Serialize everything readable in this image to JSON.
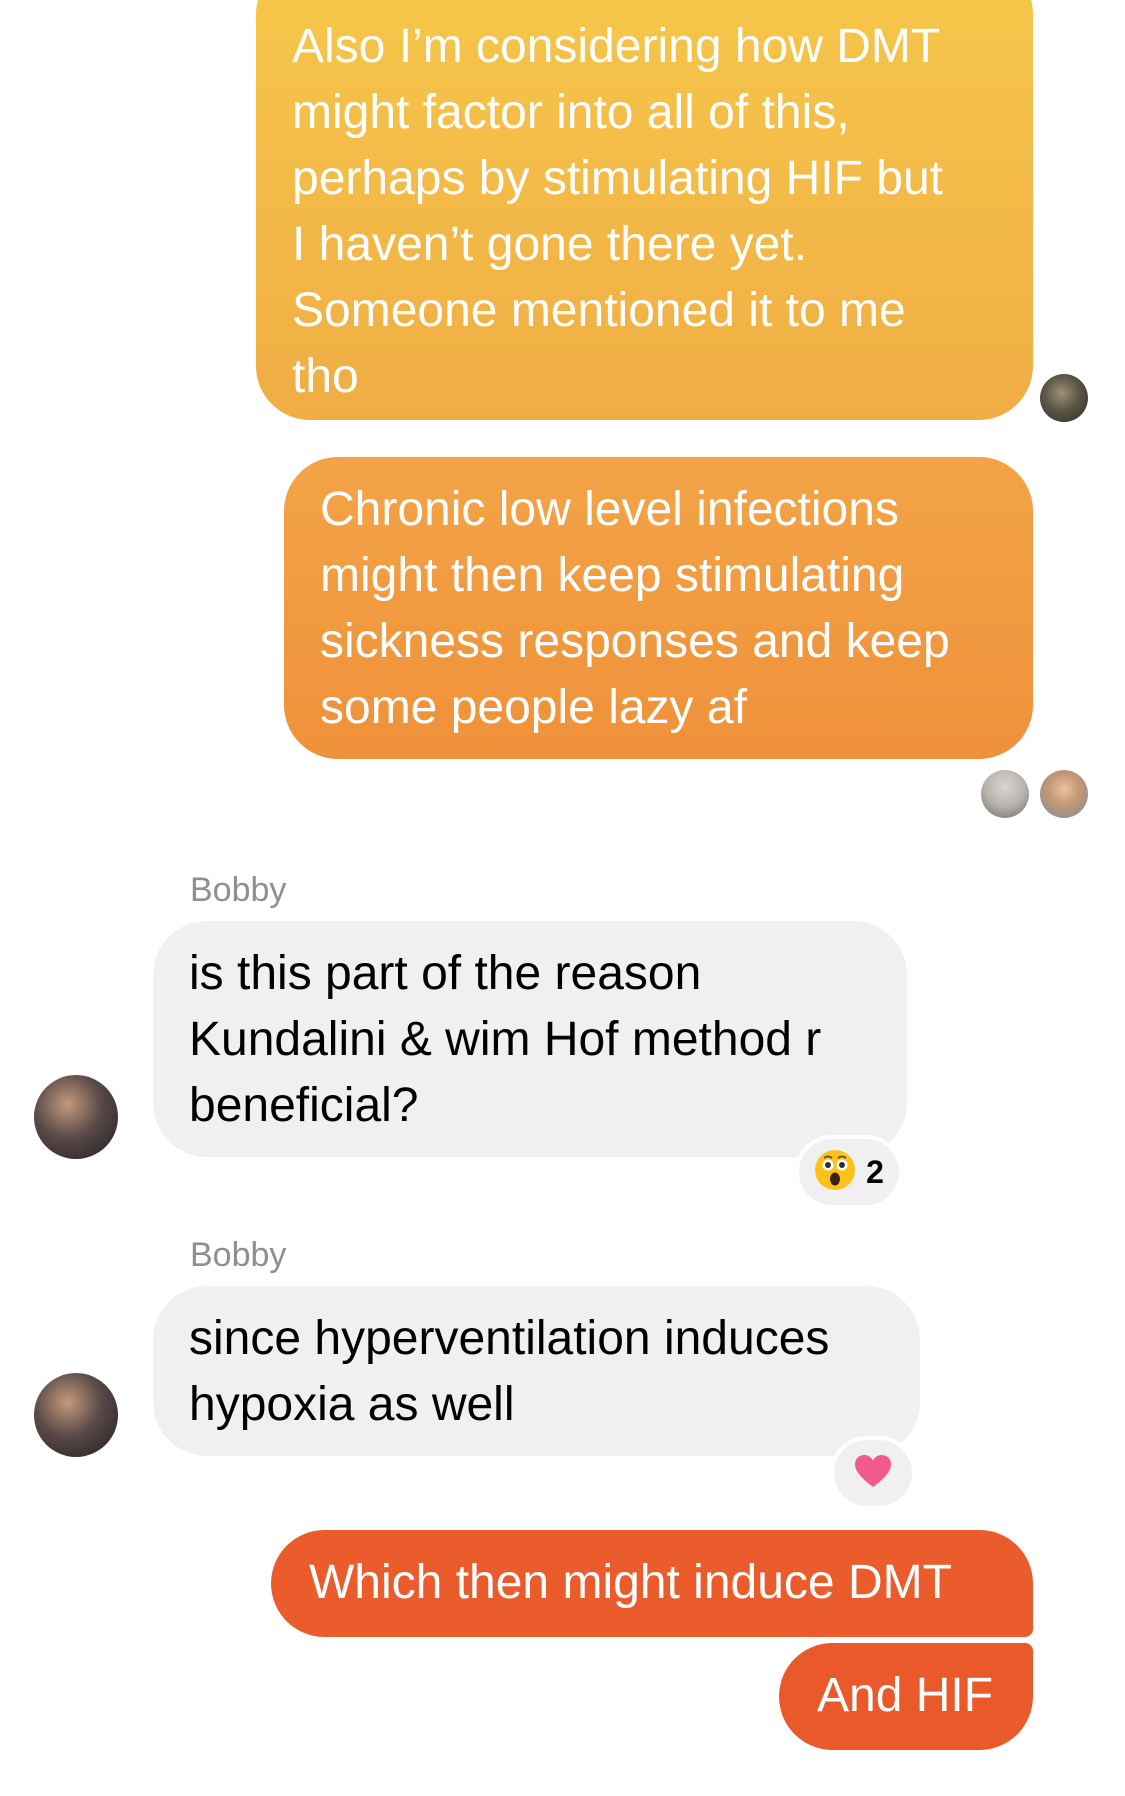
{
  "conversation": {
    "messages": [
      {
        "direction": "outgoing",
        "text": "Also I’m considering how DMT\nmight factor into all of this,\nperhaps by stimulating HIF but\nI haven’t gone there yet.\nSomeone mentioned it to me\ntho"
      },
      {
        "direction": "outgoing",
        "text": "Chronic low level infections\nmight then keep stimulating\nsickness responses and keep\nsome people lazy af"
      },
      {
        "direction": "incoming",
        "sender": "Bobby",
        "text": "is this part of the reason\nKundalini & wim Hof method r\nbeneficial?",
        "reaction": {
          "icon": "astonished-face-emoji",
          "count": "2"
        }
      },
      {
        "direction": "incoming",
        "sender": "Bobby",
        "text": "since hyperventilation induces\nhypoxia as well",
        "reaction": {
          "icon": "pink-heart-emoji"
        }
      },
      {
        "direction": "outgoing",
        "text": "Which then might induce DMT"
      },
      {
        "direction": "outgoing",
        "text": "And HIF"
      }
    ]
  },
  "colors": {
    "outgoing_gradient_top": "#f6c84a",
    "outgoing_gradient_mid": "#ef913a",
    "outgoing_bottom": "#ea5c2c",
    "incoming_bubble": "#f0f0f0",
    "sender_label": "#8e8e93",
    "heart": "#f25a8c"
  }
}
